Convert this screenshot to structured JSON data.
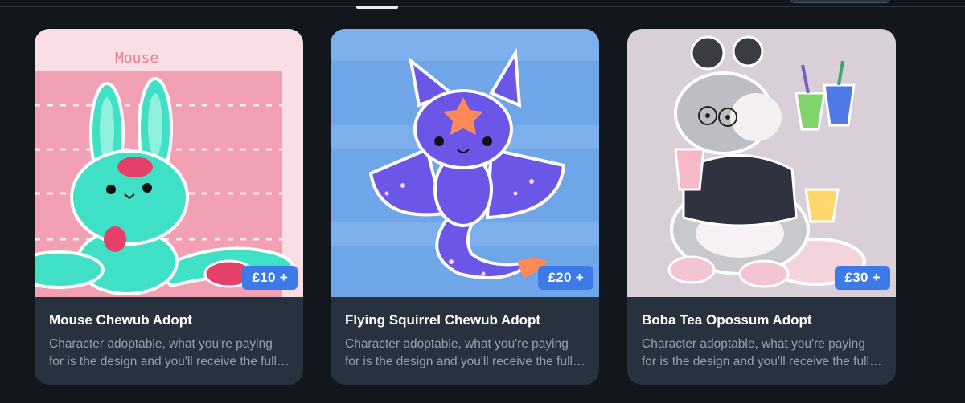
{
  "listings": [
    {
      "title": "Mouse Chewub Adopt",
      "price": "£10 +",
      "description": "Character adoptable, what you're paying for is the design and you'll receive the full character reference sheet.",
      "art_text": "Mouse",
      "palette": {
        "bg": "#f9dfe5",
        "body": "#3fe0c6",
        "accent": "#e4406a"
      }
    },
    {
      "title": "Flying Squirrel Chewub Adopt",
      "price": "£20 +",
      "description": "Character adoptable, what you're paying for is the design and you'll receive the full character reference sheet.",
      "palette": {
        "bg": "#6ea6e8",
        "body": "#6b56e8",
        "accent": "#ff8a55"
      }
    },
    {
      "title": "Boba Tea Opossum Adopt",
      "price": "£30 +",
      "description": "Character adoptable, what you're paying for is the design and you'll receive the full character reference sheet.",
      "palette": {
        "bg": "#d9cfd8",
        "body": "#b8b8bc",
        "accent": "#f2c4d4"
      }
    }
  ],
  "colors": {
    "page_bg": "#12171d",
    "card_bg": "#28323e",
    "price_badge": "#3c7ae8",
    "tab_indicator": "#e9edf2"
  }
}
